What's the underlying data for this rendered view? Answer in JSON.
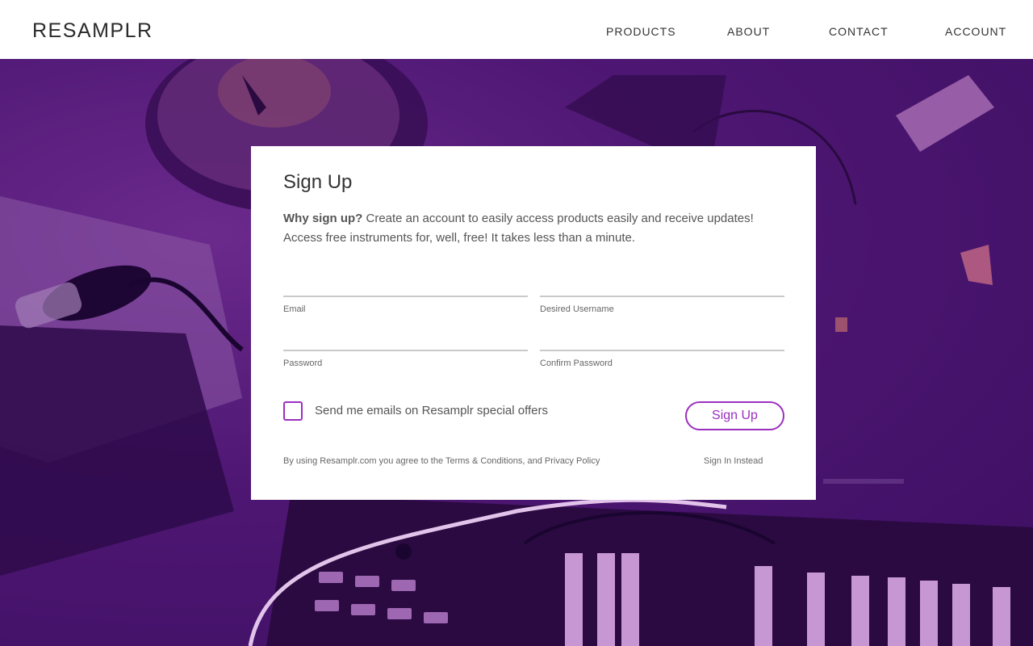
{
  "header": {
    "logo": "RESAMPLR",
    "nav": [
      "PRODUCTS",
      "ABOUT",
      "CONTACT",
      "ACCOUNT"
    ]
  },
  "form": {
    "title": "Sign Up",
    "intro_bold": "Why sign up?",
    "intro_text": " Create an account to easily access products easily and receive updates! Access free instruments for, well, free! It takes less than a minute.",
    "fields": {
      "email": {
        "label": "Email",
        "value": ""
      },
      "username": {
        "label": "Desired Username",
        "value": ""
      },
      "password": {
        "label": "Password",
        "value": ""
      },
      "confirm": {
        "label": "Confirm Password",
        "value": ""
      }
    },
    "checkbox_label": "Send me emails on Resamplr special offers",
    "checkbox_checked": false,
    "submit_label": "Sign Up",
    "terms_prefix": "By using Resamplr.com you agree to the ",
    "terms_link": "Terms & Conditions",
    "terms_mid": ", and ",
    "privacy_link": "Privacy Policy",
    "signin_label": "Sign In Instead"
  },
  "colors": {
    "accent": "#9b2fbf",
    "overlay": "#4a1470"
  }
}
